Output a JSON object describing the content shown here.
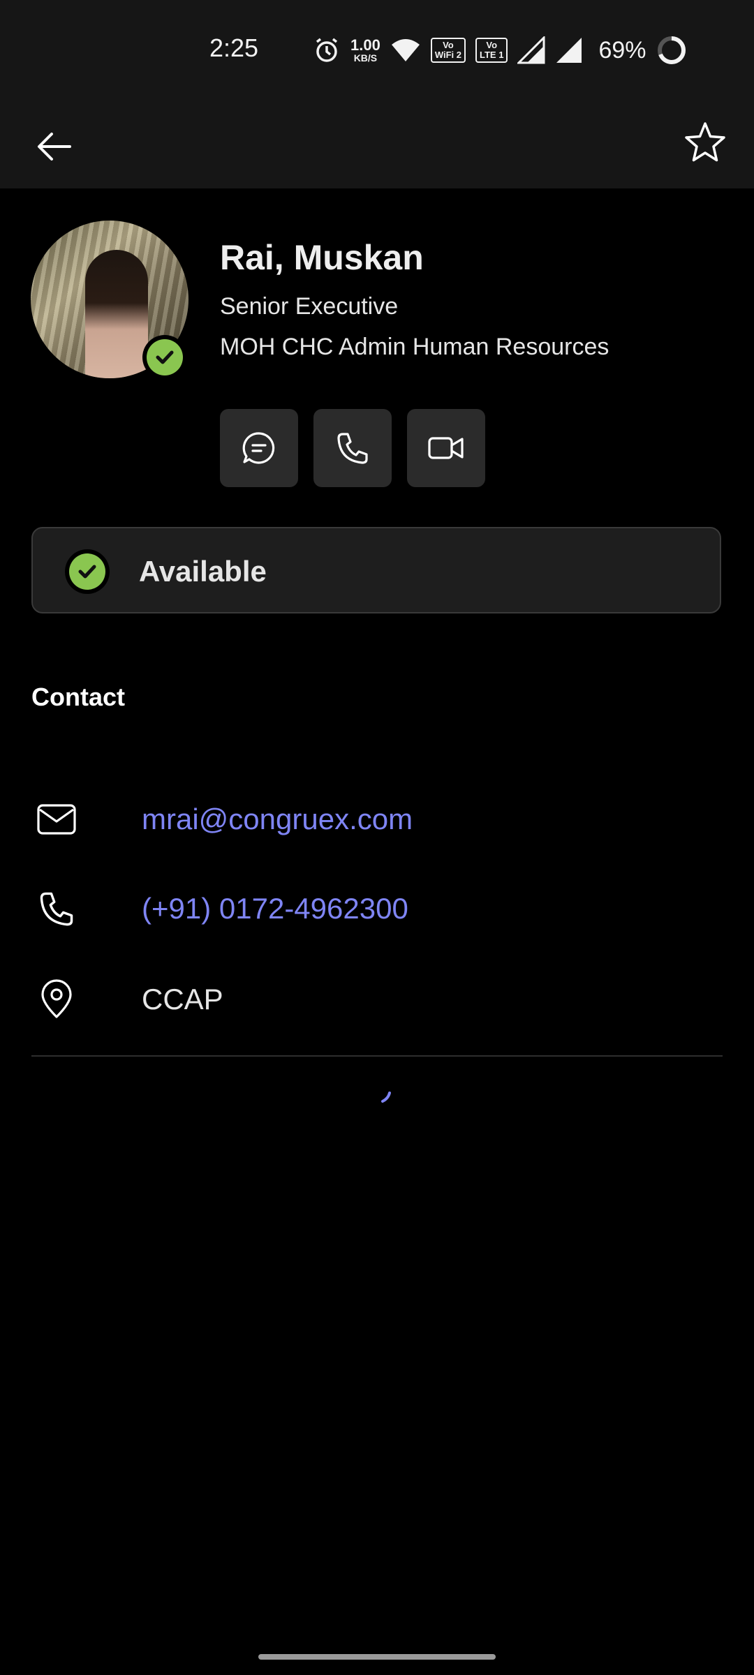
{
  "status_bar": {
    "time": "2:25",
    "net_speed_value": "1.00",
    "net_speed_unit": "KB/S",
    "volte_wifi_badge_top": "Vo",
    "volte_wifi_badge_bottom": "WiFi 2",
    "volte_lte_badge_top": "Vo",
    "volte_lte_badge_bottom": "LTE 1",
    "battery": "69%"
  },
  "app_bar": {
    "back_icon": "arrow-left-icon",
    "favorite_icon": "star-icon"
  },
  "profile": {
    "name": "Rai, Muskan",
    "title": "Senior Executive",
    "department": "MOH CHC Admin Human Resources",
    "presence_color": "#8ac650",
    "actions": [
      {
        "icon": "chat-icon"
      },
      {
        "icon": "phone-icon"
      },
      {
        "icon": "video-icon"
      }
    ]
  },
  "presence": {
    "label": "Available"
  },
  "contact": {
    "heading": "Contact",
    "email": "mrai@congruex.com",
    "phone": "(+91) 0172-4962300",
    "location": "CCAP",
    "link_color": "#7f85f5"
  }
}
